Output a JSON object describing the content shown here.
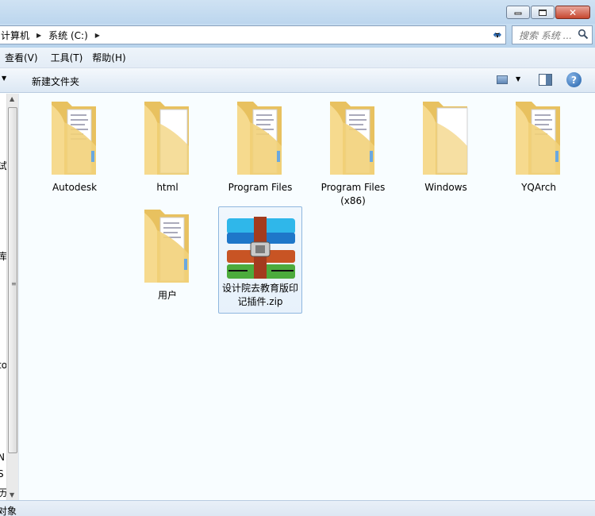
{
  "window": {
    "minimize_icon": "minimize-icon",
    "maximize_icon": "maximize-icon",
    "close_icon": "close-icon"
  },
  "address": {
    "crumbs": [
      "计算机",
      "系统 (C:)"
    ],
    "search_placeholder": "搜索 系统 ..."
  },
  "menu": {
    "items": [
      "查看(V)",
      "工具(T)",
      "帮助(H)"
    ]
  },
  "toolbar": {
    "new_folder": "新建文件夹"
  },
  "nav": {
    "fragments": [
      "试",
      "库",
      "to",
      "N",
      "S",
      "历"
    ]
  },
  "files": [
    {
      "name": "Autodesk",
      "type": "folder"
    },
    {
      "name": "html",
      "type": "folder-empty"
    },
    {
      "name": "Program Files",
      "type": "folder"
    },
    {
      "name": "Program Files (x86)",
      "type": "folder"
    },
    {
      "name": "Windows",
      "type": "folder-empty"
    },
    {
      "name": "YQArch",
      "type": "folder"
    },
    {
      "name": "用户",
      "type": "folder"
    },
    {
      "name": "设计院去教育版印记插件.zip",
      "type": "zip-archive"
    }
  ],
  "status": {
    "text": "对象"
  },
  "colors": {
    "folder_yellow": "#f3d27c",
    "selection_border": "#8fb7df",
    "zip_blue": "#2a8fd6",
    "zip_red": "#c2502b",
    "zip_green": "#4aa846"
  }
}
